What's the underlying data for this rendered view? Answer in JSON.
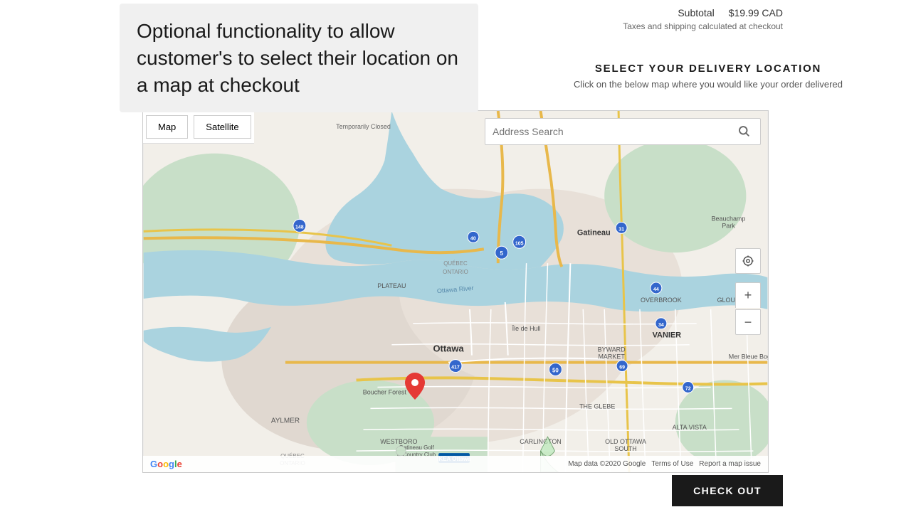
{
  "header": {
    "subtotal_label": "Subtotal",
    "subtotal_value": "$19.99 CAD",
    "taxes_note": "Taxes and shipping calculated at checkout"
  },
  "feature_tooltip": {
    "text": "Optional functionality to allow customer's to select their location on a map at checkout"
  },
  "delivery": {
    "title": "SELECT YOUR DELIVERY LOCATION",
    "subtitle": "Click on the below map where you would like your order delivered"
  },
  "map": {
    "tab_map": "Map",
    "tab_satellite": "Satellite",
    "address_placeholder": "Address Search",
    "footer_data": "Map data ©2020 Google",
    "footer_terms": "Terms of Use",
    "footer_report": "Report a map issue"
  },
  "checkout": {
    "label": "CHECK OUT"
  }
}
